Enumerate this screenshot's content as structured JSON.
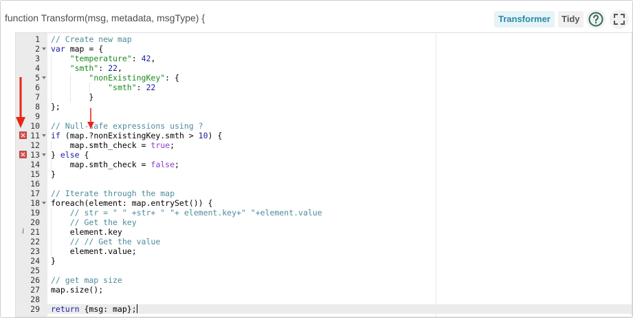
{
  "header": {
    "function_signature": "function Transform(msg, metadata, msgType) {",
    "transformer_label": "Transformer",
    "tidy_label": "Tidy"
  },
  "editor": {
    "lines": [
      {
        "n": "1",
        "fold": false,
        "marker": "",
        "indent": 0,
        "tokens": [
          {
            "t": "// Create new map",
            "c": "cm"
          }
        ]
      },
      {
        "n": "2",
        "fold": true,
        "marker": "",
        "indent": 0,
        "tokens": [
          {
            "t": "var",
            "c": "kw"
          },
          {
            "t": " map = {",
            "c": ""
          }
        ]
      },
      {
        "n": "3",
        "fold": false,
        "marker": "",
        "indent": 1,
        "tokens": [
          {
            "t": "    ",
            "c": ""
          },
          {
            "t": "\"temperature\"",
            "c": "str"
          },
          {
            "t": ": ",
            "c": ""
          },
          {
            "t": "42",
            "c": "num"
          },
          {
            "t": ",",
            "c": ""
          }
        ]
      },
      {
        "n": "4",
        "fold": false,
        "marker": "",
        "indent": 1,
        "tokens": [
          {
            "t": "    ",
            "c": ""
          },
          {
            "t": "\"smth\"",
            "c": "str"
          },
          {
            "t": ": ",
            "c": ""
          },
          {
            "t": "22",
            "c": "num"
          },
          {
            "t": ",",
            "c": ""
          }
        ]
      },
      {
        "n": "5",
        "fold": true,
        "marker": "",
        "indent": 2,
        "tokens": [
          {
            "t": "        ",
            "c": ""
          },
          {
            "t": "\"nonExistingKey\"",
            "c": "str"
          },
          {
            "t": ": {",
            "c": ""
          }
        ]
      },
      {
        "n": "6",
        "fold": false,
        "marker": "",
        "indent": 3,
        "tokens": [
          {
            "t": "            ",
            "c": ""
          },
          {
            "t": "\"smth\"",
            "c": "str"
          },
          {
            "t": ": ",
            "c": ""
          },
          {
            "t": "22",
            "c": "num"
          }
        ]
      },
      {
        "n": "7",
        "fold": false,
        "marker": "",
        "indent": 2,
        "tokens": [
          {
            "t": "        }",
            "c": ""
          }
        ]
      },
      {
        "n": "8",
        "fold": false,
        "marker": "",
        "indent": 0,
        "tokens": [
          {
            "t": "};",
            "c": ""
          }
        ]
      },
      {
        "n": "9",
        "fold": false,
        "marker": "",
        "indent": 0,
        "tokens": []
      },
      {
        "n": "10",
        "fold": false,
        "marker": "",
        "indent": 0,
        "tokens": [
          {
            "t": "// Null-safe expressions using ?",
            "c": "cm"
          }
        ]
      },
      {
        "n": "11",
        "fold": true,
        "marker": "error",
        "indent": 0,
        "tokens": [
          {
            "t": "if",
            "c": "kw"
          },
          {
            "t": " (map.?nonExistingKey.smth > ",
            "c": ""
          },
          {
            "t": "10",
            "c": "num"
          },
          {
            "t": ") {",
            "c": ""
          }
        ]
      },
      {
        "n": "12",
        "fold": false,
        "marker": "",
        "indent": 1,
        "tokens": [
          {
            "t": "    map.smth_check = ",
            "c": ""
          },
          {
            "t": "true",
            "c": "bool"
          },
          {
            "t": ";",
            "c": ""
          }
        ]
      },
      {
        "n": "13",
        "fold": true,
        "marker": "error",
        "indent": 0,
        "tokens": [
          {
            "t": "} ",
            "c": ""
          },
          {
            "t": "else",
            "c": "kw"
          },
          {
            "t": " {",
            "c": ""
          }
        ]
      },
      {
        "n": "14",
        "fold": false,
        "marker": "",
        "indent": 1,
        "tokens": [
          {
            "t": "    map.smth_check = ",
            "c": ""
          },
          {
            "t": "false",
            "c": "bool"
          },
          {
            "t": ";",
            "c": ""
          }
        ]
      },
      {
        "n": "15",
        "fold": false,
        "marker": "",
        "indent": 0,
        "tokens": [
          {
            "t": "}",
            "c": ""
          }
        ]
      },
      {
        "n": "16",
        "fold": false,
        "marker": "",
        "indent": 0,
        "tokens": []
      },
      {
        "n": "17",
        "fold": false,
        "marker": "",
        "indent": 0,
        "tokens": [
          {
            "t": "// Iterate through the map",
            "c": "cm"
          }
        ]
      },
      {
        "n": "18",
        "fold": true,
        "marker": "",
        "indent": 0,
        "tokens": [
          {
            "t": "foreach(element: map.entrySet()) {",
            "c": ""
          }
        ]
      },
      {
        "n": "19",
        "fold": false,
        "marker": "",
        "indent": 1,
        "tokens": [
          {
            "t": "    ",
            "c": ""
          },
          {
            "t": "// str = \" \" +str+ \" \"+ element.key+\" \"+element.value",
            "c": "cm"
          }
        ]
      },
      {
        "n": "20",
        "fold": false,
        "marker": "",
        "indent": 1,
        "tokens": [
          {
            "t": "    ",
            "c": ""
          },
          {
            "t": "// Get the key",
            "c": "cm"
          }
        ]
      },
      {
        "n": "21",
        "fold": false,
        "marker": "info",
        "indent": 1,
        "tokens": [
          {
            "t": "    element.key",
            "c": ""
          }
        ]
      },
      {
        "n": "22",
        "fold": false,
        "marker": "",
        "indent": 1,
        "tokens": [
          {
            "t": "    ",
            "c": ""
          },
          {
            "t": "// // Get the value",
            "c": "cm"
          }
        ]
      },
      {
        "n": "23",
        "fold": false,
        "marker": "",
        "indent": 1,
        "tokens": [
          {
            "t": "    element.value;",
            "c": ""
          }
        ]
      },
      {
        "n": "24",
        "fold": false,
        "marker": "",
        "indent": 0,
        "tokens": [
          {
            "t": "}",
            "c": ""
          }
        ]
      },
      {
        "n": "25",
        "fold": false,
        "marker": "",
        "indent": 0,
        "tokens": []
      },
      {
        "n": "26",
        "fold": false,
        "marker": "",
        "indent": 0,
        "tokens": [
          {
            "t": "// get map size",
            "c": "cm"
          }
        ]
      },
      {
        "n": "27",
        "fold": false,
        "marker": "",
        "indent": 0,
        "tokens": [
          {
            "t": "map.size();",
            "c": ""
          }
        ]
      },
      {
        "n": "28",
        "fold": false,
        "marker": "",
        "indent": 0,
        "tokens": []
      },
      {
        "n": "29",
        "fold": false,
        "marker": "",
        "indent": 0,
        "active": true,
        "tokens": [
          {
            "t": "return",
            "c": "kw"
          },
          {
            "t": " {msg: map};",
            "c": ""
          }
        ]
      }
    ]
  },
  "colors": {
    "accent": "#2a8aa8",
    "error": "#d9534f",
    "annotation_arrow": "#e8261a"
  },
  "icons": {
    "help": "help-circle-icon",
    "fullscreen": "fullscreen-icon",
    "error": "error-icon",
    "info": "info-icon",
    "fold": "fold-arrow-icon"
  }
}
